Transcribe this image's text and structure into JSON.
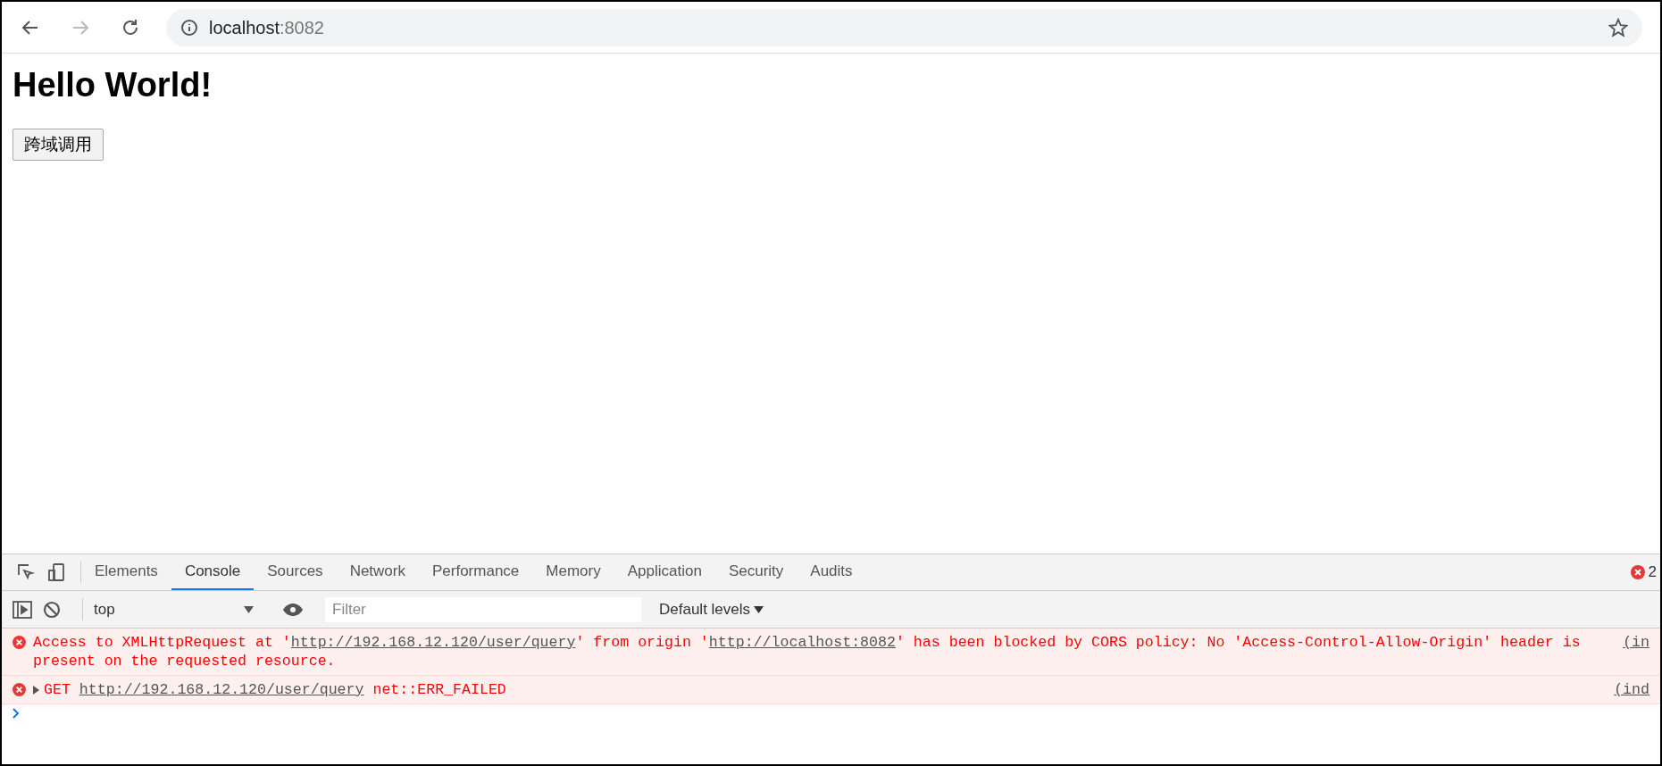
{
  "browser": {
    "back_disabled": false,
    "forward_disabled": true,
    "address_host": "localhost",
    "address_port": ":8082"
  },
  "page": {
    "heading": "Hello World!",
    "button": "跨域调用"
  },
  "devtools": {
    "tabs": [
      {
        "label": "Elements",
        "selected": false
      },
      {
        "label": "Console",
        "selected": true
      },
      {
        "label": "Sources",
        "selected": false
      },
      {
        "label": "Network",
        "selected": false
      },
      {
        "label": "Performance",
        "selected": false
      },
      {
        "label": "Memory",
        "selected": false
      },
      {
        "label": "Application",
        "selected": false
      },
      {
        "label": "Security",
        "selected": false
      },
      {
        "label": "Audits",
        "selected": false
      }
    ],
    "error_count": "2",
    "context": "top",
    "filter": {
      "placeholder": "Filter"
    },
    "levels": "Default levels",
    "messages": [
      {
        "expandable": false,
        "segments": [
          {
            "kind": "text",
            "text": "Access to XMLHttpRequest at '"
          },
          {
            "kind": "link",
            "text": "http://192.168.12.120/user/query"
          },
          {
            "kind": "text",
            "text": "' from origin '"
          },
          {
            "kind": "link",
            "text": "http://localhost:8082"
          },
          {
            "kind": "text",
            "text": "' has been blocked by CORS policy: No 'Access-Control-Allow-Origin' header is present on the requested resource."
          }
        ],
        "source": "(in"
      },
      {
        "expandable": true,
        "segments": [
          {
            "kind": "text",
            "text": "GET "
          },
          {
            "kind": "link",
            "text": "http://192.168.12.120/user/query"
          },
          {
            "kind": "text",
            "text": " net::ERR_FAILED"
          }
        ],
        "source": "(ind"
      }
    ]
  }
}
